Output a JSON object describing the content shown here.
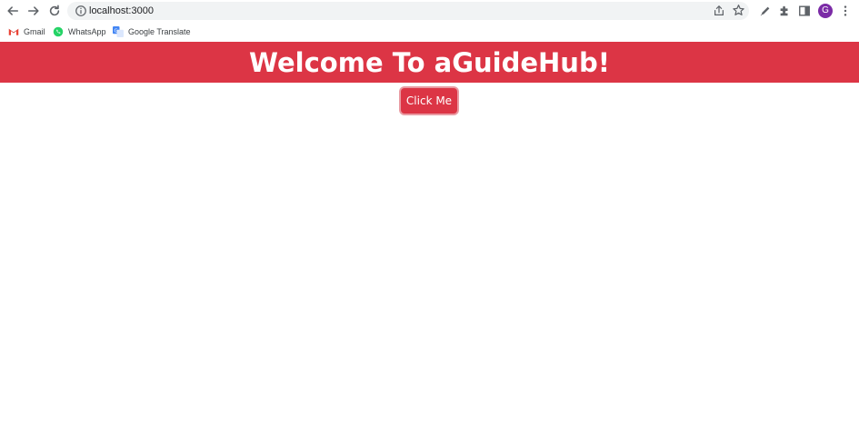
{
  "browser": {
    "url": "localhost:3000",
    "avatar_letter": "G",
    "toolbar_icons": [
      "back-arrow-icon",
      "forward-arrow-icon",
      "reload-icon",
      "info-icon",
      "share-icon",
      "star-icon",
      "pen-icon",
      "extensions-puzzle-icon",
      "side-panel-icon",
      "avatar",
      "menu-kebab-icon"
    ]
  },
  "bookmarks": [
    {
      "label": "Gmail",
      "icon": "gmail-icon"
    },
    {
      "label": "WhatsApp",
      "icon": "whatsapp-icon"
    },
    {
      "label": "Google Translate",
      "icon": "google-translate-icon"
    }
  ],
  "page": {
    "heading": "Welcome To aGuideHub!",
    "button_label": "Click Me",
    "accent_color": "#dc3545"
  }
}
